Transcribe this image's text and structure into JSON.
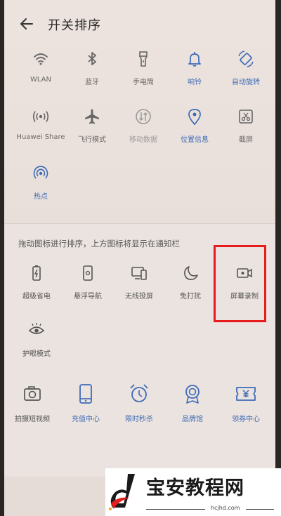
{
  "header": {
    "title": "开关排序"
  },
  "enabled_tiles": [
    {
      "label": "WLAN",
      "icon": "wifi-icon"
    },
    {
      "label": "蓝牙",
      "icon": "bluetooth-icon"
    },
    {
      "label": "手电筒",
      "icon": "flashlight-icon"
    },
    {
      "label": "响铃",
      "icon": "bell-icon"
    },
    {
      "label": "自动旋转",
      "icon": "auto-rotate-icon"
    },
    {
      "label": "Huawei Share",
      "icon": "huawei-share-icon"
    },
    {
      "label": "飞行模式",
      "icon": "airplane-icon"
    },
    {
      "label": "移动数据",
      "icon": "mobile-data-icon"
    },
    {
      "label": "位置信息",
      "icon": "location-icon"
    },
    {
      "label": "截屏",
      "icon": "screenshot-icon"
    },
    {
      "label": "热点",
      "icon": "hotspot-icon"
    }
  ],
  "hint": "拖动图标进行排序，上方图标将显示在通知栏",
  "available_tiles": [
    {
      "label": "超级省电",
      "icon": "battery-saver-icon"
    },
    {
      "label": "悬浮导航",
      "icon": "floating-nav-icon"
    },
    {
      "label": "无线投屏",
      "icon": "wireless-projection-icon"
    },
    {
      "label": "免打扰",
      "icon": "moon-icon"
    },
    {
      "label": "屏幕录制",
      "icon": "screen-record-icon"
    },
    {
      "label": "护眼模式",
      "icon": "eye-comfort-icon"
    }
  ],
  "services": [
    {
      "label": "拍摄短视频",
      "icon": "camera-icon"
    },
    {
      "label": "充值中心",
      "icon": "phone-recharge-icon"
    },
    {
      "label": "限时秒杀",
      "icon": "alarm-clock-icon"
    },
    {
      "label": "品牌馆",
      "icon": "badge-icon"
    },
    {
      "label": "领券中心",
      "icon": "coupon-icon"
    }
  ],
  "watermark": {
    "name": "宝安教程网",
    "url": "hcjhd.com"
  },
  "colors": {
    "accent_blue": "#3e6bb7",
    "highlight_red": "#e81c1c"
  }
}
